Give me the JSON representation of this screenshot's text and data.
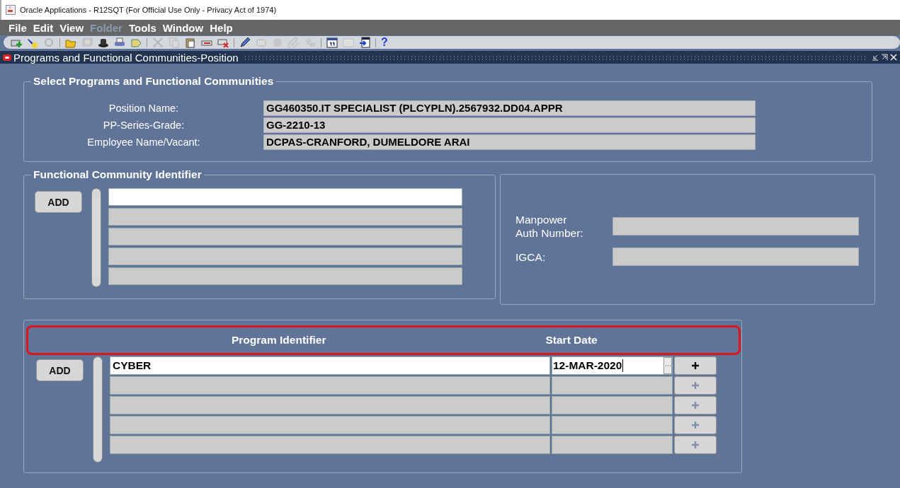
{
  "window": {
    "title": "Oracle Applications - R12SQT (For Official Use Only - Privacy Act of 1974)"
  },
  "menu": [
    {
      "label": "File",
      "disabled": false
    },
    {
      "label": "Edit",
      "disabled": false
    },
    {
      "label": "View",
      "disabled": false
    },
    {
      "label": "Folder",
      "disabled": true
    },
    {
      "label": "Tools",
      "disabled": false
    },
    {
      "label": "Window",
      "disabled": false
    },
    {
      "label": "Help",
      "disabled": false
    }
  ],
  "toolbar": [
    {
      "kind": "button",
      "disabled": false
    },
    {
      "kind": "button",
      "disabled": false
    },
    {
      "kind": "button",
      "disabled": true
    },
    {
      "kind": "separator"
    },
    {
      "kind": "button",
      "disabled": false
    },
    {
      "kind": "button",
      "disabled": true
    },
    {
      "kind": "button",
      "disabled": false
    },
    {
      "kind": "button",
      "disabled": false
    },
    {
      "kind": "button",
      "disabled": false
    },
    {
      "kind": "separator"
    },
    {
      "kind": "button",
      "disabled": true
    },
    {
      "kind": "button",
      "disabled": true
    },
    {
      "kind": "button",
      "disabled": false
    },
    {
      "kind": "button",
      "disabled": false
    },
    {
      "kind": "button",
      "disabled": false
    },
    {
      "kind": "separator"
    },
    {
      "kind": "button",
      "disabled": false
    },
    {
      "kind": "button",
      "disabled": true
    },
    {
      "kind": "button",
      "disabled": true
    },
    {
      "kind": "button",
      "disabled": true
    },
    {
      "kind": "button",
      "disabled": true
    },
    {
      "kind": "separator"
    },
    {
      "kind": "button",
      "disabled": false
    },
    {
      "kind": "button",
      "disabled": true
    },
    {
      "kind": "button",
      "disabled": false
    },
    {
      "kind": "separator"
    },
    {
      "kind": "help",
      "label": "?"
    }
  ],
  "form": {
    "title": "Programs and Functional Communities-Position",
    "position_section": {
      "legend": "Select Programs and Functional Communities",
      "fields": [
        {
          "label": "Position Name:",
          "value": "GG460350.IT SPECIALIST (PLCYPLN).2567932.DD04.APPR"
        },
        {
          "label": "PP-Series-Grade:",
          "value": "GG-2210-13"
        },
        {
          "label": "Employee Name/Vacant:",
          "value": "DCPAS-CRANFORD, DUMELDORE ARAI"
        }
      ]
    },
    "community_section": {
      "legend": "Functional Community Identifier",
      "add_button": "ADD",
      "rows": [
        {
          "current": true
        },
        {
          "current": false
        },
        {
          "current": false
        },
        {
          "current": false
        },
        {
          "current": false
        }
      ]
    },
    "manpower_section": {
      "fields": [
        {
          "label": "Manpower\nAuth Number:"
        },
        {
          "label": "IGCA:"
        }
      ]
    },
    "program_section": {
      "add_button": "ADD",
      "columns": [
        "Program Identifier",
        "Start Date"
      ],
      "rows": [
        {
          "program": "CYBER",
          "start_date": "12-MAR-2020",
          "current": true,
          "add_disabled": false
        },
        {
          "current": false,
          "add_disabled": true
        },
        {
          "current": false,
          "add_disabled": true
        },
        {
          "current": false,
          "add_disabled": true
        },
        {
          "current": false,
          "add_disabled": true
        }
      ]
    }
  }
}
